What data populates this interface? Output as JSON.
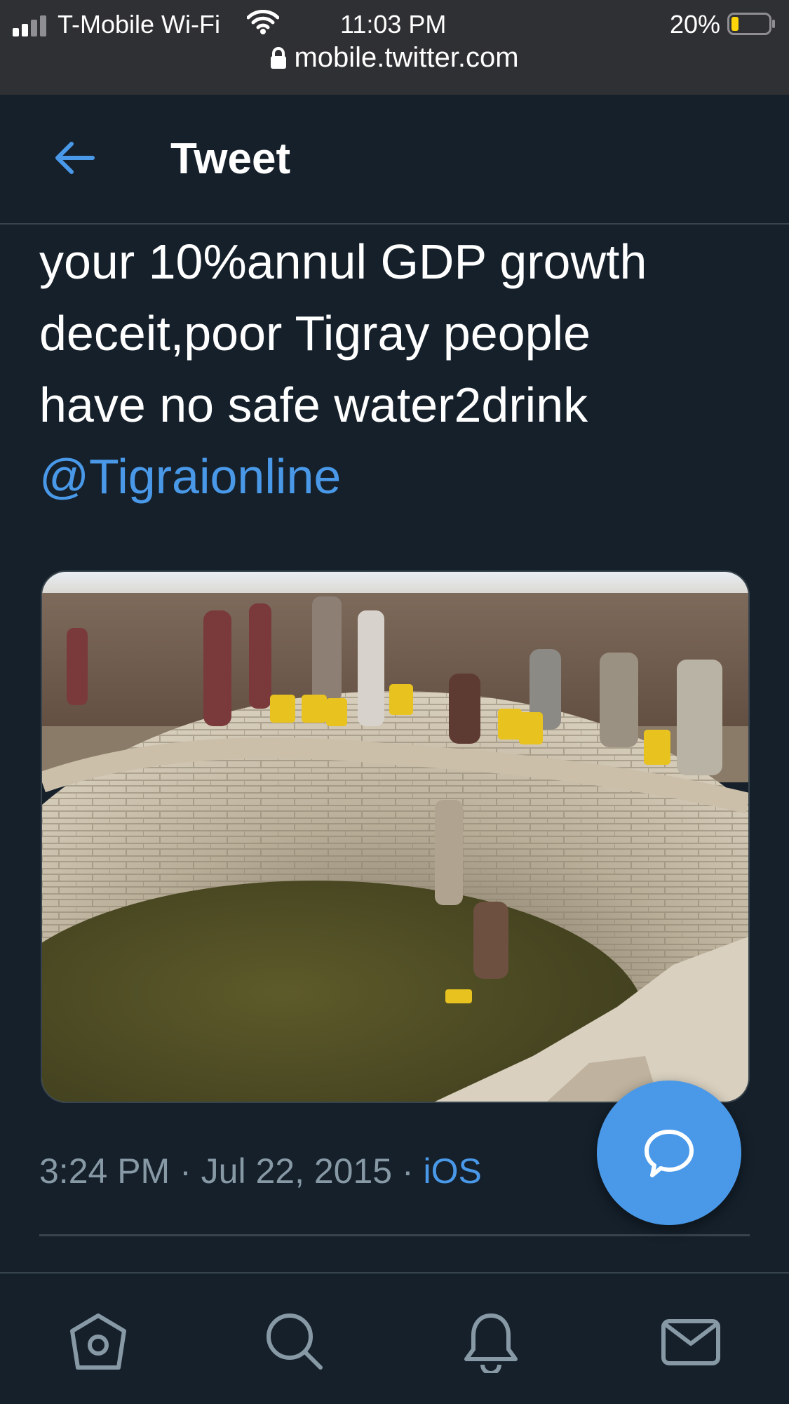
{
  "status_bar": {
    "carrier": "T-Mobile Wi-Fi",
    "time": "11:03 PM",
    "battery_percent": "20%",
    "battery_level": 0.2,
    "url": "mobile.twitter.com"
  },
  "header": {
    "title": "Tweet"
  },
  "tweet": {
    "text_lines": [
      "your 10%annul GDP growth",
      "deceit,poor Tigray people",
      "have no safe water2drink"
    ],
    "mention": "@Tigraionline",
    "timestamp": "3:24 PM · Jul 22, 2015 · ",
    "source": "iOS"
  },
  "colors": {
    "background": "#15202b",
    "accent": "#4a99e9",
    "muted": "#8899a6",
    "status_bar": "#2f3033"
  },
  "icons": {
    "back": "arrow-left-icon",
    "reply_fab": "speech-bubble-icon",
    "nav": [
      "home-icon",
      "search-icon",
      "bell-icon",
      "mail-icon"
    ]
  }
}
